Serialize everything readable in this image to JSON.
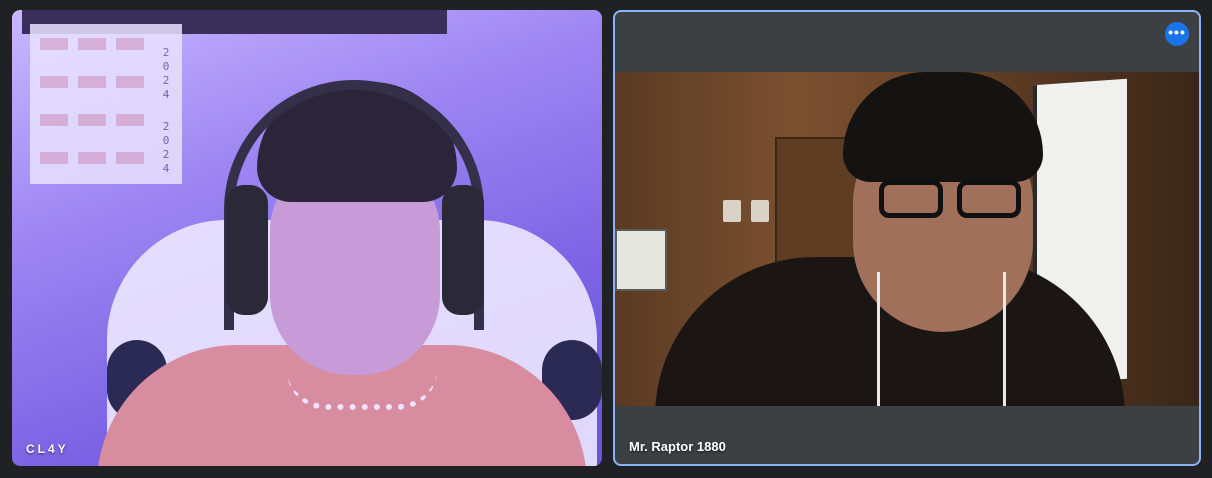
{
  "participants": [
    {
      "name": "CL4Y",
      "video_on": true,
      "speaking": false
    },
    {
      "name": "Mr. Raptor 1880",
      "video_on": true,
      "speaking": true
    }
  ],
  "left_tile": {
    "calendar_year_top": [
      "2",
      "0",
      "2",
      "4"
    ],
    "calendar_year_bottom": [
      "2",
      "0",
      "2",
      "4"
    ]
  },
  "right_tile": {
    "more_options_icon": "more-horiz-icon",
    "more_options_glyph": "•••"
  },
  "colors": {
    "background": "#202124",
    "active_speaker_border": "#8ab4f8",
    "more_button": "#1a73e8"
  }
}
